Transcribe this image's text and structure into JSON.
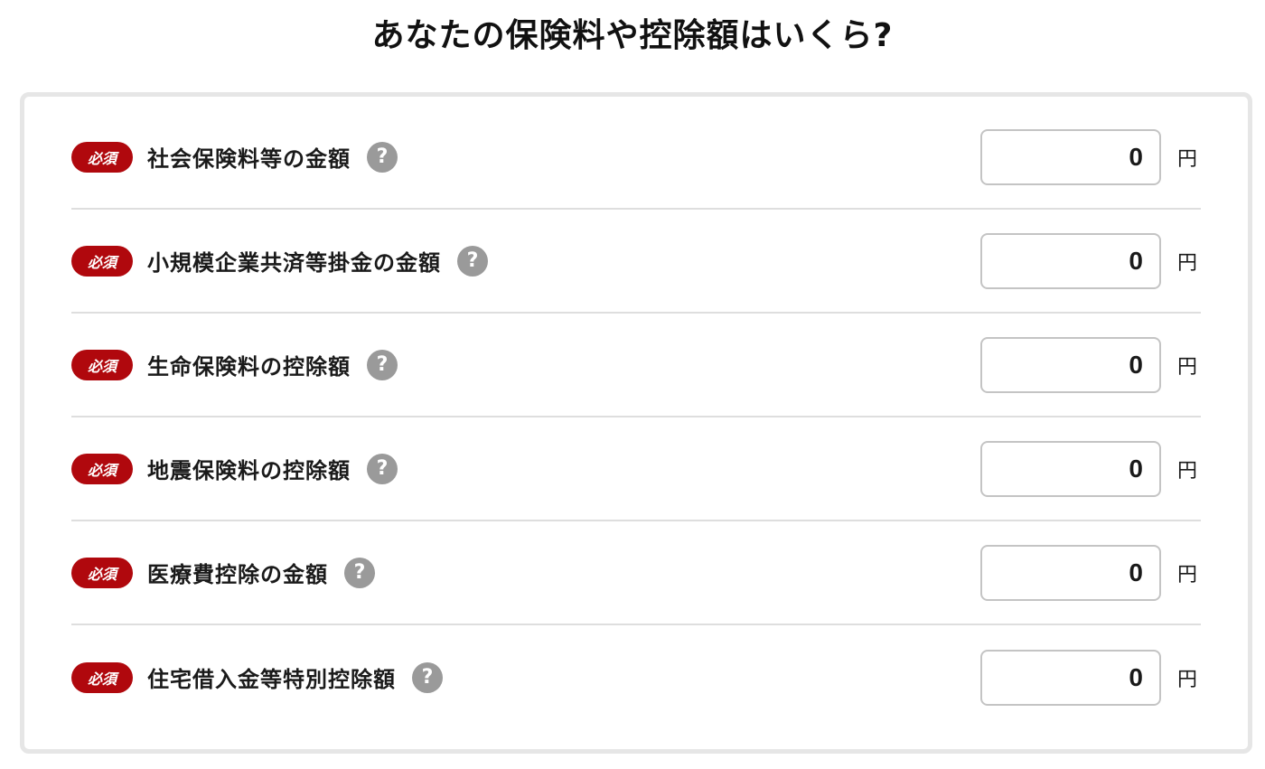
{
  "page": {
    "title": "あなたの保険料や控除額はいくら?"
  },
  "form": {
    "rows": [
      {
        "badge": "必須",
        "label": "社会保険料等の金額",
        "help": "?",
        "value": "0",
        "unit": "円"
      },
      {
        "badge": "必須",
        "label": "小規模企業共済等掛金の金額",
        "help": "?",
        "value": "0",
        "unit": "円"
      },
      {
        "badge": "必須",
        "label": "生命保険料の控除額",
        "help": "?",
        "value": "0",
        "unit": "円"
      },
      {
        "badge": "必須",
        "label": "地震保険料の控除額",
        "help": "?",
        "value": "0",
        "unit": "円"
      },
      {
        "badge": "必須",
        "label": "医療費控除の金額",
        "help": "?",
        "value": "0",
        "unit": "円"
      },
      {
        "badge": "必須",
        "label": "住宅借入金等特別控除額",
        "help": "?",
        "value": "0",
        "unit": "円"
      }
    ]
  },
  "colors": {
    "badge": "#b0080d",
    "help_icon": "#9a9a9a",
    "card_border": "#e6e6e6",
    "divider": "#dedede"
  }
}
